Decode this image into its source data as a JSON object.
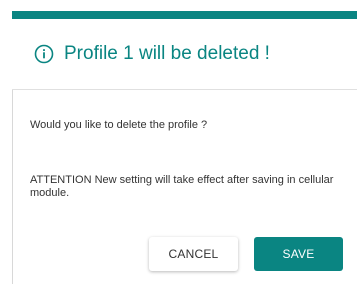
{
  "dialog": {
    "title": "Profile 1 will be deleted !",
    "question": "Would you like to delete the profile ?",
    "attention": "ATTENTION New setting will take effect after saving in cellular module.",
    "cancel_label": "CANCEL",
    "save_label": "SAVE"
  },
  "icons": {
    "header": "info-icon"
  },
  "colors": {
    "accent": "#0a8582",
    "text": "#333333"
  }
}
